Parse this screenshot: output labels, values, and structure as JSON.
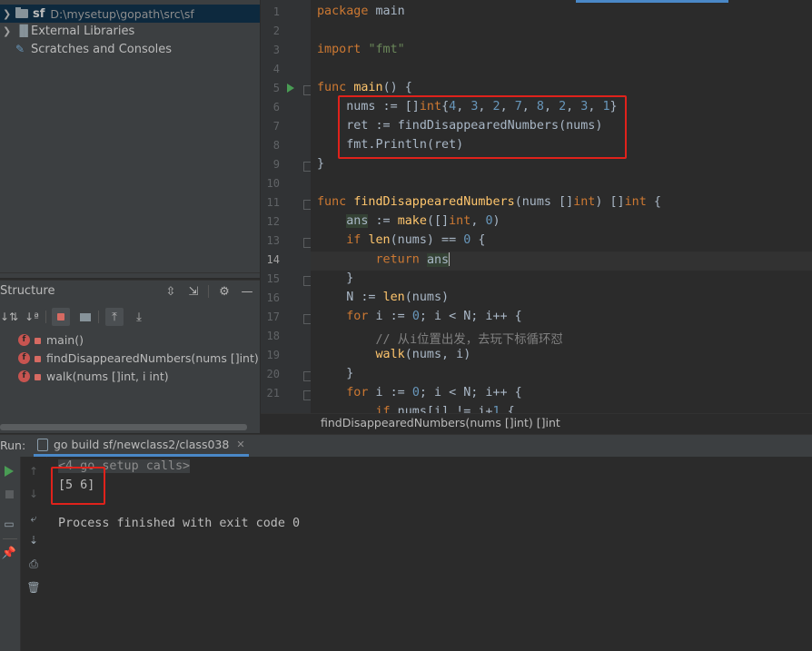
{
  "project": {
    "root_name": "sf",
    "root_path": "D:\\mysetup\\gopath\\src\\sf",
    "external_libraries": "External Libraries",
    "scratches": "Scratches and Consoles"
  },
  "structure": {
    "title": "Structure",
    "items": [
      {
        "badge": "f",
        "label": "main()"
      },
      {
        "badge": "f",
        "label": "findDisappearedNumbers(nums []int) []int"
      },
      {
        "badge": "f",
        "label": "walk(nums []int, i int)"
      }
    ]
  },
  "editor": {
    "line_numbers": [
      "1",
      "2",
      "3",
      "4",
      "5",
      "6",
      "7",
      "8",
      "9",
      "10",
      "11",
      "12",
      "13",
      "14",
      "15",
      "16",
      "17",
      "18",
      "19",
      "20",
      "21"
    ],
    "current_line": "14",
    "breadcrumb": "findDisappearedNumbers(nums []int) []int"
  },
  "run": {
    "label": "Run:",
    "tab_title": "go build sf/newclass2/class038",
    "console": {
      "setup_calls": "<4 go setup calls>",
      "output": "[5 6]",
      "exit_message": "Process finished with exit code 0"
    }
  },
  "colors": {
    "highlight_box": "#e0221b",
    "keyword": "#cc7832",
    "string": "#6a8759",
    "number": "#6897bb",
    "function": "#ffc66d"
  }
}
